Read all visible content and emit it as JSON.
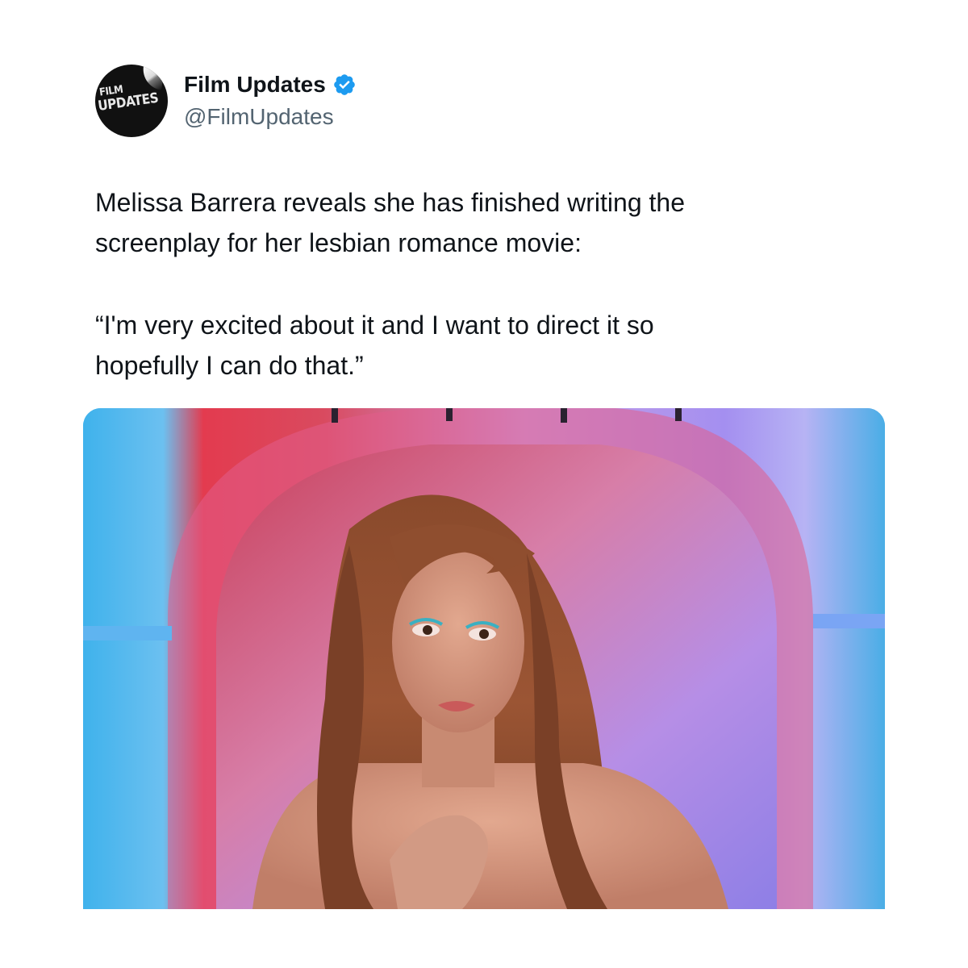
{
  "account": {
    "display_name": "Film Updates",
    "handle": "@FilmUpdates",
    "avatar_logo_line1": "FILM",
    "avatar_logo_line2": "UPDATES",
    "verified_color": "#1d9bf0"
  },
  "tweet": {
    "paragraph1": "Melissa Barrera reveals she has finished writing the\nscreenplay for her lesbian romance movie:",
    "paragraph2": "“I'm very excited about it and I want to direct it so\nhopefully I can do that.”"
  },
  "media": {
    "kind": "photo",
    "subject": "woman-with-long-auburn-hair-in-colorful-arch"
  }
}
